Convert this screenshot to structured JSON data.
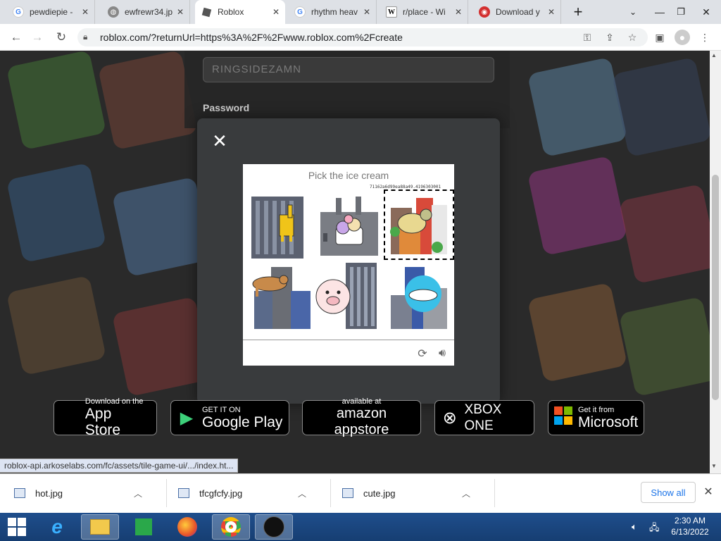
{
  "tabs": [
    {
      "title": "pewdiepie -",
      "favicon": "google-icon",
      "active": false
    },
    {
      "title": "ewfrewr34.jp",
      "favicon": "globe-icon",
      "active": false
    },
    {
      "title": "Roblox",
      "favicon": "roblox-icon",
      "active": true
    },
    {
      "title": "rhythm heav",
      "favicon": "google-icon",
      "active": false
    },
    {
      "title": "r/place - Wi",
      "favicon": "wikipedia-icon",
      "active": false
    },
    {
      "title": "Download y",
      "favicon": "download-site-icon",
      "active": false
    }
  ],
  "address_bar": {
    "url": "roblox.com/?returnUrl=https%3A%2F%2Fwww.roblox.com%2Fcreate"
  },
  "login": {
    "username_value": "RINGSIDEZAMN",
    "password_label": "Password"
  },
  "captcha": {
    "prompt": "Pick the ice cream",
    "session_hash": "71162a6d99ea88a49.4196303001",
    "tiles": [
      {
        "content": "giraffe on building",
        "selected": false
      },
      {
        "content": "ice cream in factory",
        "selected": false
      },
      {
        "content": "turtle on buildings",
        "selected": true
      },
      {
        "content": "camel on building",
        "selected": false
      },
      {
        "content": "pig with skyscraper",
        "selected": false
      },
      {
        "content": "shark on building",
        "selected": false
      }
    ]
  },
  "store_badges": [
    {
      "small": "Download on the",
      "large": "App Store",
      "icon": "apple-icon"
    },
    {
      "small": "GET IT ON",
      "large": "Google Play",
      "icon": "google-play-icon"
    },
    {
      "small": "available at",
      "large": "amazon appstore",
      "icon": "amazon-icon"
    },
    {
      "small": "",
      "large": "XBOX ONE",
      "icon": "xbox-icon"
    },
    {
      "small": "Get it from",
      "large": "Microsoft",
      "icon": "microsoft-icon"
    }
  ],
  "status_url": "roblox-api.arkoselabs.com/fc/assets/tile-game-ui/.../index.ht...",
  "downloads": [
    {
      "name": "hot.jpg"
    },
    {
      "name": "tfcgfcfy.jpg"
    },
    {
      "name": "cute.jpg"
    }
  ],
  "downloads_show_all": "Show all",
  "taskbar": {
    "time": "2:30 AM",
    "date": "6/13/2022"
  },
  "colors": {
    "accent_blue": "#1a73e8",
    "taskbar": "#1f4e8c",
    "modal_bg": "#393b3d"
  }
}
